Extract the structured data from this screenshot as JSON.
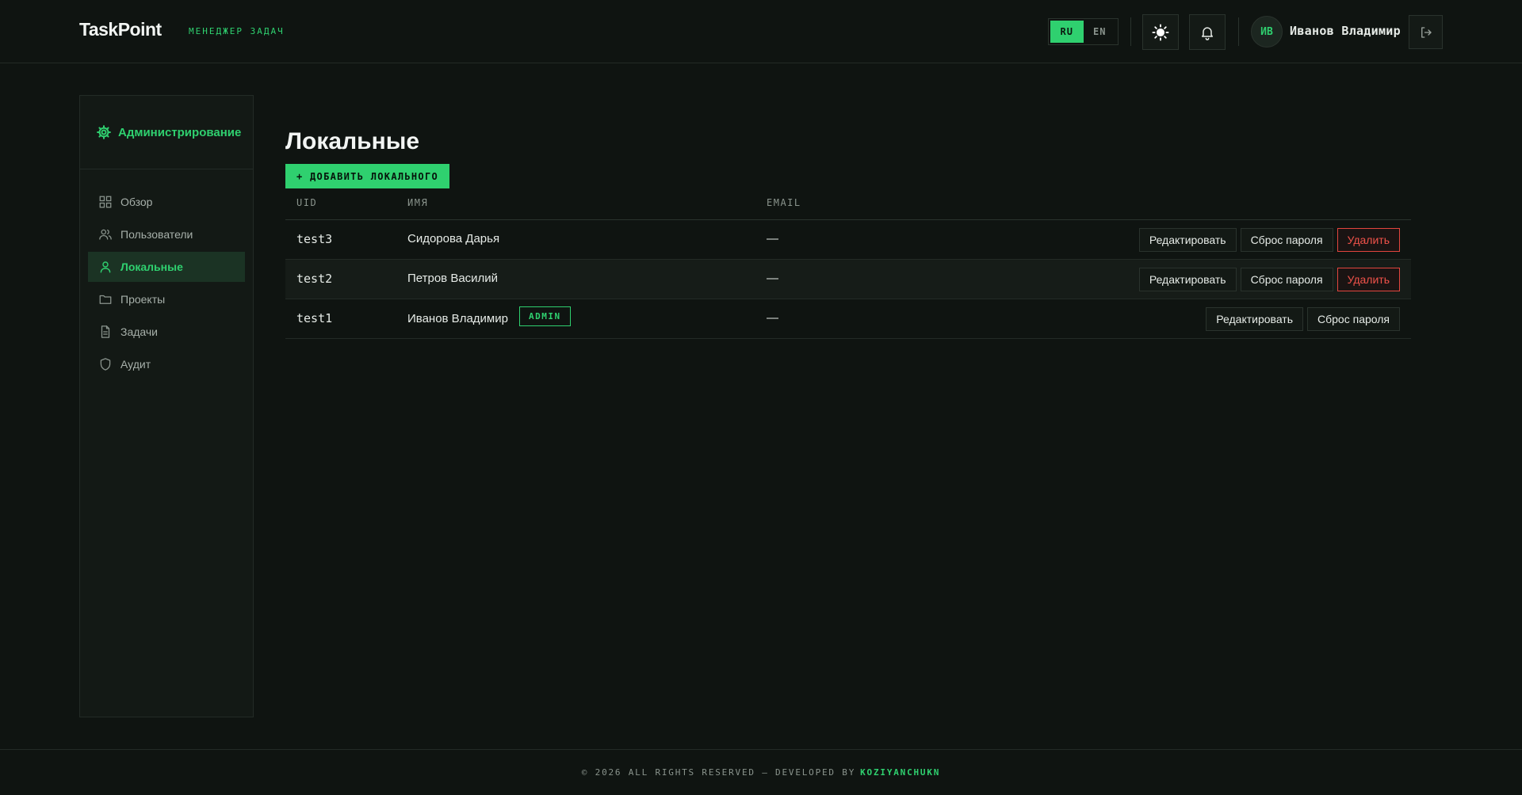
{
  "brand": {
    "name": "TaskPoint",
    "subtitle": "МЕНЕДЖЕР ЗАДАЧ"
  },
  "header": {
    "languages": [
      {
        "code": "RU",
        "active": true
      },
      {
        "code": "EN",
        "active": false
      }
    ],
    "user_initials": "ИВ",
    "user_name": "Иванов Владимир",
    "icons": {
      "theme": "sun-icon",
      "notifications": "bell-icon",
      "logout": "logout-icon"
    }
  },
  "sidebar": {
    "title": "Администрирование",
    "items": [
      {
        "label": "Обзор",
        "icon": "grid-icon",
        "active": false
      },
      {
        "label": "Пользователи",
        "icon": "users-icon",
        "active": false
      },
      {
        "label": "Локальные",
        "icon": "user-icon",
        "active": true
      },
      {
        "label": "Проекты",
        "icon": "folder-icon",
        "active": false
      },
      {
        "label": "Задачи",
        "icon": "document-icon",
        "active": false
      },
      {
        "label": "Аудит",
        "icon": "shield-icon",
        "active": false
      }
    ]
  },
  "main": {
    "title": "Локальные",
    "add_button": "+ ДОБАВИТЬ ЛОКАЛЬНОГО",
    "table": {
      "headers": {
        "uid": "UID",
        "name": "ИМЯ",
        "email": "EMAIL"
      },
      "actions": {
        "edit": "Редактировать",
        "reset": "Сброс пароля",
        "delete": "Удалить"
      },
      "rows": [
        {
          "uid": "test3",
          "name": "Сидорова Дарья",
          "email": "—",
          "badge": "",
          "can_delete": true
        },
        {
          "uid": "test2",
          "name": "Петров Василий",
          "email": "—",
          "badge": "",
          "can_delete": true
        },
        {
          "uid": "test1",
          "name": "Иванов Владимир",
          "email": "—",
          "badge": "ADMIN",
          "can_delete": false
        }
      ]
    }
  },
  "footer": {
    "text": "© 2026 ALL RIGHTS RESERVED — DEVELOPED BY",
    "developer": "KOZIYANCHUKN"
  },
  "colors": {
    "accent": "#2fd06f",
    "danger": "#f0524a",
    "background": "#0f1411"
  }
}
